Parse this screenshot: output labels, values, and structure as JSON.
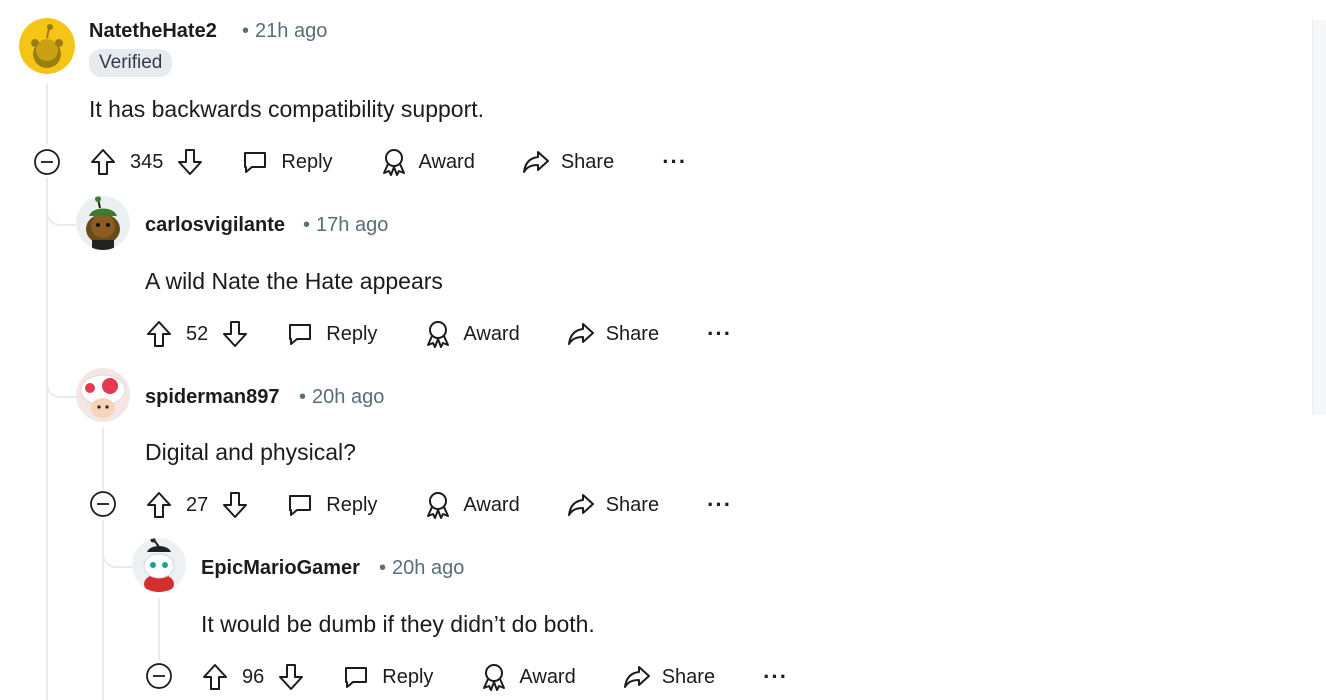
{
  "comments": [
    {
      "username": "NatetheHate2",
      "time": "21h ago",
      "badge": "Verified",
      "body": "It has backwards compatibility support.",
      "score": "345",
      "avatar_color": "#f5c516"
    },
    {
      "username": "carlosvigilante",
      "time": "17h ago",
      "body": "A wild Nate the Hate appears",
      "score": "52",
      "avatar_color": "#6aa84f"
    },
    {
      "username": "spiderman897",
      "time": "20h ago",
      "body": "Digital and physical?",
      "score": "27",
      "avatar_color": "#e23a4e"
    },
    {
      "username": "EpicMarioGamer",
      "time": "20h ago",
      "body": "It would be dumb if they didn’t do both.",
      "score": "96",
      "avatar_color": "#d32f2f"
    }
  ],
  "actions": {
    "reply": "Reply",
    "award": "Award",
    "share": "Share",
    "more": "···"
  },
  "separator": "•"
}
